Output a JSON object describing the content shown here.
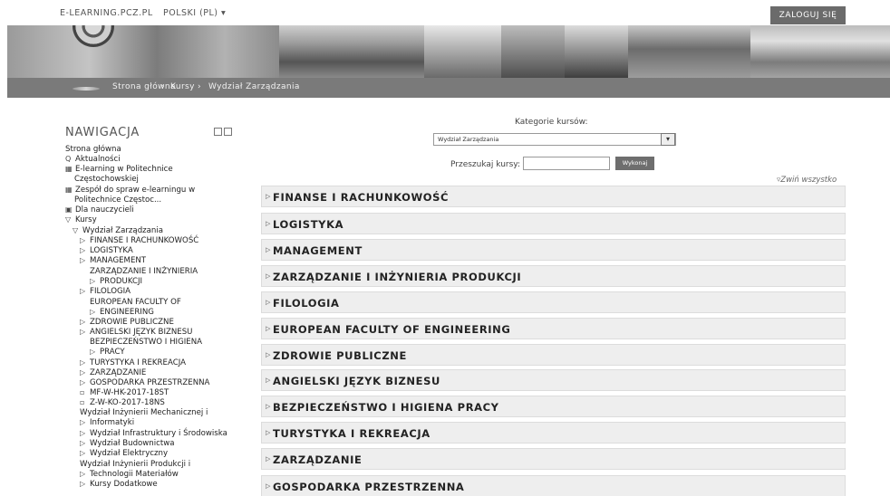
{
  "topbar": {
    "site": "E-LEARNING.PCZ.PL",
    "language": "POLSKI (PL)",
    "language_caret": "▾",
    "login": "ZALOGUJ SIĘ"
  },
  "breadcrumb": [
    {
      "label": "Strona główna",
      "sep": "›"
    },
    {
      "label": "Kursy",
      "sep": "›"
    },
    {
      "label": "Wydział Zarządzania",
      "sep": ""
    }
  ],
  "navigation": {
    "title": "NAWIGACJA",
    "items": [
      {
        "icon": "",
        "label": "Strona główna"
      },
      {
        "icon": "Q",
        "label": "Aktualności"
      },
      {
        "icon": "▦",
        "label": "E-learning w Politechnice"
      },
      {
        "icon": "",
        "label": "Częstochowskiej"
      },
      {
        "icon": "▦",
        "label": "Zespół do spraw e-learningu w"
      },
      {
        "icon": "",
        "label": "Politechnice Częstoc..."
      },
      {
        "icon": "▣",
        "label": "Dla nauczycieli"
      },
      {
        "icon": "▽",
        "label": "Kursy"
      },
      {
        "icon": "▽",
        "label": "Wydział Zarządzania"
      },
      {
        "icon": "▷",
        "label": "FINANSE I RACHUNKOWOŚĆ"
      },
      {
        "icon": "▷",
        "label": "LOGISTYKA"
      },
      {
        "icon": "▷",
        "label": "MANAGEMENT"
      },
      {
        "icon": "",
        "label": "ZARZĄDZANIE I INŻYNIERIA"
      },
      {
        "icon": "▷",
        "label": "PRODUKCJI"
      },
      {
        "icon": "▷",
        "label": "FILOLOGIA"
      },
      {
        "icon": "",
        "label": "EUROPEAN FACULTY OF"
      },
      {
        "icon": "▷",
        "label": "ENGINEERING"
      },
      {
        "icon": "▷",
        "label": "ZDROWIE PUBLICZNE"
      },
      {
        "icon": "▷",
        "label": "ANGIELSKI JĘZYK BIZNESU"
      },
      {
        "icon": "",
        "label": "BEZPIECZEŃSTWO I HIGIENA"
      },
      {
        "icon": "▷",
        "label": "PRACY"
      },
      {
        "icon": "▷",
        "label": "TURYSTYKA I REKREACJA"
      },
      {
        "icon": "▷",
        "label": "ZARZĄDZANIE"
      },
      {
        "icon": "▷",
        "label": "GOSPODARKA PRZESTRZENNA"
      },
      {
        "icon": "▫",
        "label": "MF-W-HK-2017-18ST"
      },
      {
        "icon": "▫",
        "label": "Z-W-KO-2017-18NS"
      },
      {
        "icon": "",
        "label": "Wydział Inżynierii Mechanicznej i"
      },
      {
        "icon": "▷",
        "label": "Informatyki"
      },
      {
        "icon": "▷",
        "label": "Wydział Infrastruktury i Środowiska"
      },
      {
        "icon": "▷",
        "label": "Wydział Budownictwa"
      },
      {
        "icon": "▷",
        "label": "Wydział Elektryczny"
      },
      {
        "icon": "",
        "label": "Wydział Inżynierii Produkcji i"
      },
      {
        "icon": "▷",
        "label": "Technologii Materiałów"
      },
      {
        "icon": "▷",
        "label": "Kursy Dodatkowe"
      }
    ]
  },
  "main": {
    "categories_label": "Kategorie kursów:",
    "selected_category": "Wydział Zarządzania",
    "select_arrow": "▾",
    "search_label": "Przeszukaj kursy:",
    "search_value": "",
    "search_button": "Wykonaj",
    "collapse_all": "▿Zwiń wszystko",
    "categories": [
      {
        "icon": "▷",
        "label": "FINANSE I RACHUNKOWOŚĆ"
      },
      {
        "icon": "▷",
        "label": "LOGISTYKA"
      },
      {
        "icon": "▷",
        "label": "MANAGEMENT"
      },
      {
        "icon": "▷",
        "label": "ZARZĄDZANIE I INŻYNIERIA PRODUKCJI"
      },
      {
        "icon": "▷",
        "label": "FILOLOGIA"
      },
      {
        "icon": "▷",
        "label": "EUROPEAN FACULTY OF ENGINEERING"
      },
      {
        "icon": "▷",
        "label": "ZDROWIE PUBLICZNE"
      },
      {
        "icon": "▷",
        "label": "ANGIELSKI JĘZYK BIZNESU"
      },
      {
        "icon": "▷",
        "label": "BEZPIECZEŃSTWO I HIGIENA PRACY"
      },
      {
        "icon": "▷",
        "label": "TURYSTYKA I REKREACJA"
      },
      {
        "icon": "▷",
        "label": "ZARZĄDZANIE"
      },
      {
        "icon": "▷",
        "label": "GOSPODARKA PRZESTRZENNA"
      }
    ]
  },
  "colors": {
    "bar_gray": "#7a7a7a",
    "login_gray": "#6b6b6b",
    "category_bg": "#eeeeee"
  }
}
